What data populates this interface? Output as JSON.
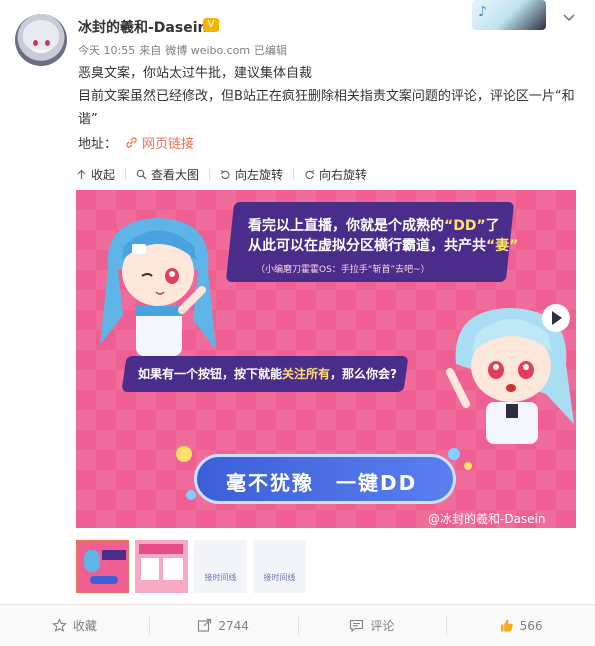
{
  "header": {
    "username": "冰封的羲和-Dasein",
    "vip_badge": "V",
    "time": "今天 10:55",
    "source_prefix": "来自",
    "source": "微博 weibo.com",
    "edited": "已编辑"
  },
  "post": {
    "lines": [
      "恶臭文案，你站太过牛批，建议集体自裁",
      "目前文案虽然已经修改，但B站正在疯狂删除相关指责文案问题的评论，评论区一片“和谐”"
    ],
    "address_label": "地址：",
    "link_label": "网页链接"
  },
  "media_toolbar": {
    "collapse": "收起",
    "view_large": "查看大图",
    "rotate_left": "向左旋转",
    "rotate_right": "向右旋转"
  },
  "image": {
    "bubble1_prefix": "看完以上直播，你就是个成熟的",
    "bubble1_dd": "“DD”",
    "bubble1_suffix": "了",
    "bubble1_line2_prefix": "从此可以在虚拟分区横行霸道，共产共",
    "bubble1_qi": "“妻”",
    "bubble1_sub": "（小编磨刀霍霍OS：手拉手“斩首”去吧~）",
    "bubble2_prefix": "如果有一个按钮，按下就能",
    "bubble2_hl": "关注所有",
    "bubble2_suffix": "，那么你会?",
    "button_text": "毫不犹豫　一键DD",
    "watermark": "@冰封的羲和-Dasein"
  },
  "thumbnails": [
    {
      "label": ""
    },
    {
      "label": ""
    },
    {
      "label": "接时间线"
    },
    {
      "label": "接时间线"
    }
  ],
  "actions": {
    "favorite": "收藏",
    "repost_count": "2744",
    "comment": "评论",
    "like_count": "566"
  },
  "colors": {
    "link": "#eb7350",
    "image_bg": "#ef5f92",
    "bubble": "#4a2d8a",
    "button": "#3b5fd6"
  }
}
